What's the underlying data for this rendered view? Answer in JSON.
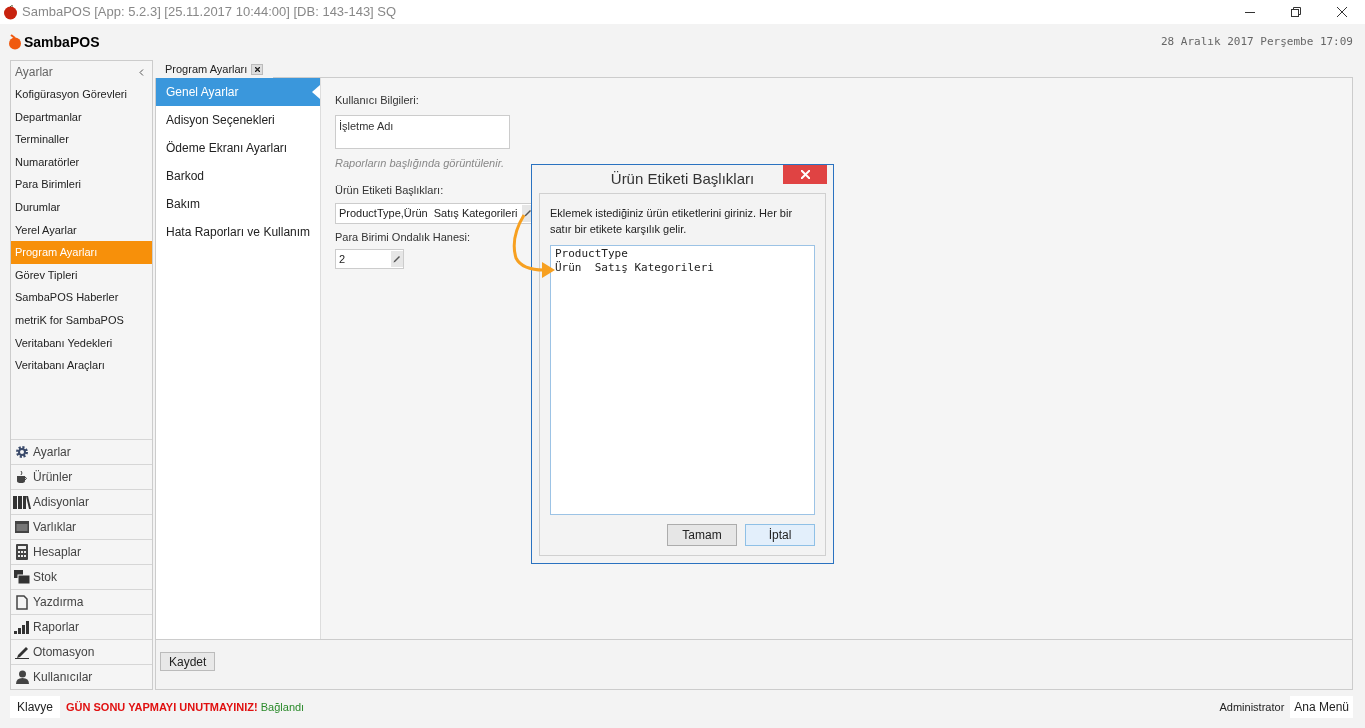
{
  "window": {
    "title": "SambaPOS [App: 5.2.3] [25.11.2017 10:44:00] [DB: 143-143] SQ"
  },
  "header": {
    "logo": "SambaPOS",
    "datetime": "28 Aralık 2017 Perşembe 17:09"
  },
  "sidebar": {
    "title": "Ayarlar",
    "items": [
      {
        "label": "Kofigürasyon Görevleri",
        "selected": false
      },
      {
        "label": "Departmanlar",
        "selected": false
      },
      {
        "label": "Terminaller",
        "selected": false
      },
      {
        "label": "Numaratörler",
        "selected": false
      },
      {
        "label": "Para Birimleri",
        "selected": false
      },
      {
        "label": "Durumlar",
        "selected": false
      },
      {
        "label": "Yerel Ayarlar",
        "selected": false
      },
      {
        "label": "Program Ayarları",
        "selected": true
      },
      {
        "label": "Görev Tipleri",
        "selected": false
      },
      {
        "label": "SambaPOS Haberler",
        "selected": false
      },
      {
        "label": "metriK for SambaPOS",
        "selected": false
      },
      {
        "label": "Veritabanı Yedekleri",
        "selected": false
      },
      {
        "label": "Veritabanı Araçları",
        "selected": false
      }
    ],
    "nav": [
      {
        "label": "Ayarlar",
        "kind": "gear"
      },
      {
        "label": "Ürünler",
        "kind": "cup"
      },
      {
        "label": "Adisyonlar",
        "kind": "books"
      },
      {
        "label": "Varlıklar",
        "kind": "box"
      },
      {
        "label": "Hesaplar",
        "kind": "calculator"
      },
      {
        "label": "Stok",
        "kind": "stack"
      },
      {
        "label": "Yazdırma",
        "kind": "document"
      },
      {
        "label": "Raporlar",
        "kind": "bars"
      },
      {
        "label": "Otomasyon",
        "kind": "pen"
      },
      {
        "label": "Kullanıcılar",
        "kind": "person"
      }
    ]
  },
  "tabs": [
    {
      "label": "Program Ayarları",
      "selected": true
    }
  ],
  "settings_nav": [
    {
      "label": "Genel Ayarlar",
      "selected": true
    },
    {
      "label": "Adisyon Seçenekleri",
      "selected": false
    },
    {
      "label": "Ödeme Ekranı Ayarları",
      "selected": false
    },
    {
      "label": "Barkod",
      "selected": false
    },
    {
      "label": "Bakım",
      "selected": false
    },
    {
      "label": "Hata Raporları ve Kullanım",
      "selected": false
    }
  ],
  "form": {
    "user_info_label": "Kullanıcı Bilgileri:",
    "business_name_placeholder": "İşletme Adı",
    "business_name_hint": "Raporların başlığında görüntülenir.",
    "tag_label": "Ürün Etiketi Başlıkları:",
    "tag_value": "ProductType,Ürün  Satış Kategorileri",
    "decimal_label": "Para Birimi Ondalık Hanesi:",
    "decimal_value": "2",
    "save_button": "Kaydet"
  },
  "dialog": {
    "title": "Ürün Etiketi Başlıkları",
    "instruction": "Eklemek istediğiniz ürün etiketlerini giriniz. Her bir satır bir etikete karşılık gelir.",
    "lines": [
      "ProductType",
      "Ürün  Satış Kategorileri"
    ],
    "buttons": [
      {
        "label": "Tamam",
        "selected": false
      },
      {
        "label": "İptal",
        "selected": true
      }
    ]
  },
  "status_bar": {
    "keyboard_button": "Klavye",
    "warning": "GÜN SONU YAPMAYI UNUTMAYINIZ!",
    "connection": "Bağlandı",
    "user": "Administrator",
    "main_menu_button": "Ana Menü"
  }
}
